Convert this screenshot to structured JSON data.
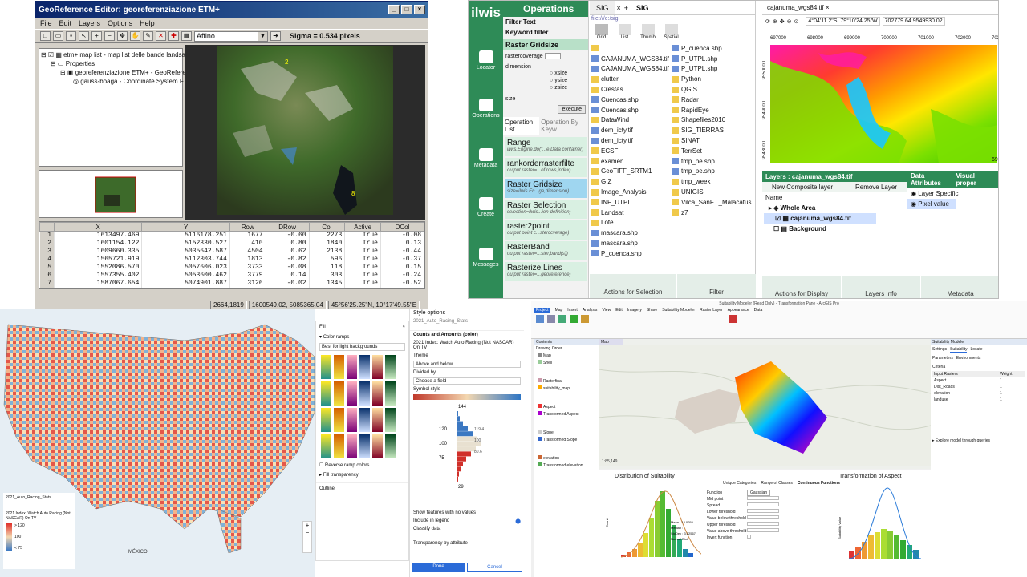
{
  "geo_editor": {
    "title": "GeoReference Editor: georeferenziazione ETM+",
    "menus": [
      "File",
      "Edit",
      "Layers",
      "Options",
      "Help"
    ],
    "combo_value": "Affino",
    "sigma": "Sigma = 0.534 pixels",
    "tree": [
      "etm+ map list - map list delle bande landsat",
      "Properties",
      "georeferenziazione ETM+ - GeoReferen",
      "gauss-boaga - Coordinate System F"
    ],
    "table_headers": [
      "",
      "X",
      "Y",
      "Row",
      "DRow",
      "Col",
      "Active",
      "DCol"
    ],
    "table_rows": [
      [
        "1",
        "1613497.469",
        "5116178.251",
        "1677",
        "-0.60",
        "2273",
        "True",
        "-0.08"
      ],
      [
        "2",
        "1601154.122",
        "5152330.527",
        "410",
        "0.80",
        "1840",
        "True",
        "0.13"
      ],
      [
        "3",
        "1609660.335",
        "5035642.587",
        "4504",
        "0.62",
        "2138",
        "True",
        "-0.44"
      ],
      [
        "4",
        "1565721.919",
        "5112303.744",
        "1813",
        "-0.82",
        "596",
        "True",
        "-0.37"
      ],
      [
        "5",
        "1552086.570",
        "5057606.023",
        "3733",
        "-0.08",
        "118",
        "True",
        "0.15"
      ],
      [
        "6",
        "1557355.402",
        "5053600.462",
        "3779",
        "0.14",
        "303",
        "True",
        "-0.24"
      ],
      [
        "7",
        "1587067.654",
        "5074901.887",
        "3126",
        "-0.02",
        "1345",
        "True",
        "-0.52"
      ]
    ],
    "status": [
      "2664,1819",
      "1600549.02, 5085365.04",
      "45°56'25.25\"N, 10°17'49.55\"E"
    ]
  },
  "ilwis": {
    "logo": "ilwis",
    "side_items": [
      "Locator",
      "Operations",
      "Metadata",
      "Create",
      "Messages"
    ],
    "operations_title": "Operations",
    "filter_text_label": "Filter Text",
    "keyword_filter_label": "Keyword filter",
    "raster_gridsize": "Raster Gridsize",
    "param_rastercoverage": "rastercoverage",
    "param_dimension": "dimension",
    "radios": [
      "xsize",
      "ysize",
      "zsize"
    ],
    "param_size": "size",
    "execute": "execute",
    "op_tabs": [
      "Operation List",
      "Operation By Keyw"
    ],
    "operations": [
      {
        "name": "Range",
        "desc": "ilwis.Engine.do(\"...e,Data container)"
      },
      {
        "name": "rankorderrasterfilte",
        "desc": "output raster=...of rows,index)"
      },
      {
        "name": "Raster Gridsize",
        "desc": "size=ilwis.En...ge,dimension)"
      },
      {
        "name": "Raster Selection",
        "desc": "selection=ilwis...ion-definition)"
      },
      {
        "name": "raster2point",
        "desc": "output point c...sterccverage)"
      },
      {
        "name": "RasterBand",
        "desc": "output raster=...ster,band(s))"
      },
      {
        "name": "Rasterize Lines",
        "desc": "output raster=...georeference)"
      }
    ],
    "catalog_tabs": [
      "SIG",
      "SIG"
    ],
    "path": "file:///e:/sig",
    "view_tabs": [
      "Grid",
      "List",
      "Thumb",
      "Spatial"
    ],
    "files_col1": [
      "..",
      "CAJANUMA_WGS84.tif",
      "CAJANUMA_WGS84.tif",
      "clutter",
      "Crestas",
      "Cuencas.shp",
      "Cuencas.shp",
      "DataWind",
      "dem_icty.tif",
      "dem_icty.tif",
      "ECSF",
      "examen",
      "GeoTIFF_SRTM1",
      "GIZ",
      "Image_Analysis",
      "INF_UTPL",
      "Landsat",
      "Lote",
      "mascara.shp",
      "mascara.shp",
      "P_cuenca.shp"
    ],
    "files_col2": [
      "P_cuenca.shp",
      "P_UTPL.shp",
      "P_UTPL.shp",
      "Python",
      "QGIS",
      "Radar",
      "RapidEye",
      "Shapefiles2010",
      "SIG_TIERRAS",
      "SINAT",
      "TerrSet",
      "tmp_pe.shp",
      "tmp_pe.shp",
      "tmp_week",
      "UNIGIS",
      "Vilca_SanF..._Malacatus",
      "z7"
    ],
    "map_tab": "cajanuma_wgs84.tif",
    "coord_readout": "4°04'11.2\"S, 79°10'24.25\"W",
    "xy_readout": "702779.64 9549930.02",
    "x_ticks": [
      "697000",
      "698000",
      "699000",
      "700000",
      "701000",
      "702000",
      "703000"
    ],
    "y_ticks": [
      "9550000",
      "9549000",
      "9548000"
    ],
    "layers_title": "Layers : cajanuma_wgs84.tif",
    "new_layer": "New Composite layer",
    "remove_layer": "Remove Layer",
    "layer_name_hdr": "Name",
    "layers": [
      "Whole Area",
      "cajanuma_wgs84.tif",
      "Background"
    ],
    "data_attrs": "Data Attributes",
    "visual_props": "Visual proper",
    "attr_items": [
      "Layer Specific",
      "Pixel value"
    ],
    "bottom_buttons": [
      "Actions for Selection",
      "Filter",
      "Actions for Display",
      "Layers Info",
      "Metadata"
    ],
    "zoom_value": "69"
  },
  "style_map": {
    "panel_title": "Style options",
    "layer": "2021_Auto_Racing_Stats",
    "section": "Counts and Amounts (color)",
    "field": "2021 Index: Watch Auto Racing (Not NASCAR) On TV",
    "theme_label": "Theme",
    "theme_value": "Above and below",
    "divided_label": "Divided by",
    "divided_value": "Choose a field",
    "symbol_style": "Symbol style",
    "fill_label": "Fill",
    "color_ramps": "Color ramps",
    "ramp_filter": "Best for light backgrounds",
    "reverse": "Reverse ramp colors",
    "fill_transparency": "Fill transparency",
    "outline": "Outline",
    "hist_max": "144",
    "hist_min": "29",
    "hist_ticks": [
      "120",
      "100",
      "75"
    ],
    "hist_values": [
      "119.4",
      "100",
      "80.6"
    ],
    "show_nodata": "Show features with no values",
    "include_legend": "Include in legend",
    "classify": "Classify data",
    "transparency_attr": "Transparency by attribute",
    "done": "Done",
    "cancel": "Cancel",
    "legend_title": "2021_Auto_Racing_Stats",
    "legend_sub": "2021 Index: Watch Auto Racing (Not NASCAR) On TV",
    "legend_items": [
      "> 120",
      "100",
      "< 75"
    ],
    "mexico": "MÉXICO"
  },
  "arcgis": {
    "title": "Suitability Modeler (Read Only) - Transformation Pane - ArcGIS Pro",
    "ribbon_tabs": [
      "Project",
      "Map",
      "Insert",
      "Analysis",
      "View",
      "Edit",
      "Imagery",
      "Share",
      "Suitability Modeler",
      "Raster Layer",
      "Appearance",
      "Data"
    ],
    "contents": "Contents",
    "drawing_order": "Drawing Order",
    "map_tab": "Map",
    "layers": [
      "Map",
      "Shell",
      "Rasterfinal",
      "suitability_map",
      "Aspect",
      "Transformed Aspect",
      "Slope",
      "Transformed Slope",
      "elevation",
      "Transformed elevation"
    ],
    "chart1_title": "Distribution of Suitability",
    "chart2_title": "Transformation of Aspect",
    "tabs": [
      "Unique Categories",
      "Range of Classes",
      "Continuous Functions"
    ],
    "function_label": "Function",
    "function_value": "Gaussian",
    "params": [
      "Mid point",
      "Spread",
      "Lower threshold",
      "Value below threshold",
      "Upper threshold",
      "Value above threshold",
      "Invert function"
    ],
    "suit_title": "Suitability Modeler",
    "suit_tabs": [
      "Settings",
      "Suitability",
      "Locate"
    ],
    "sub_tabs": [
      "Parameters",
      "Environments"
    ],
    "criteria": "Criteria",
    "crit_headers": [
      "Input Rasters",
      "Weight"
    ],
    "criteria_rows": [
      [
        "Aspect",
        "1"
      ],
      [
        "Dist_Roads",
        "1"
      ],
      [
        "elevation",
        "1"
      ],
      [
        "landuse",
        "1"
      ]
    ],
    "explore": "Explore model through queries",
    "scale": "1:85,149",
    "stats": [
      "Mean : 14.0055",
      "Median : ",
      "StdDev : 3.12567",
      "Normal Dist."
    ],
    "y_label_suit": "Suitability Value",
    "y_label_count": "Count"
  }
}
